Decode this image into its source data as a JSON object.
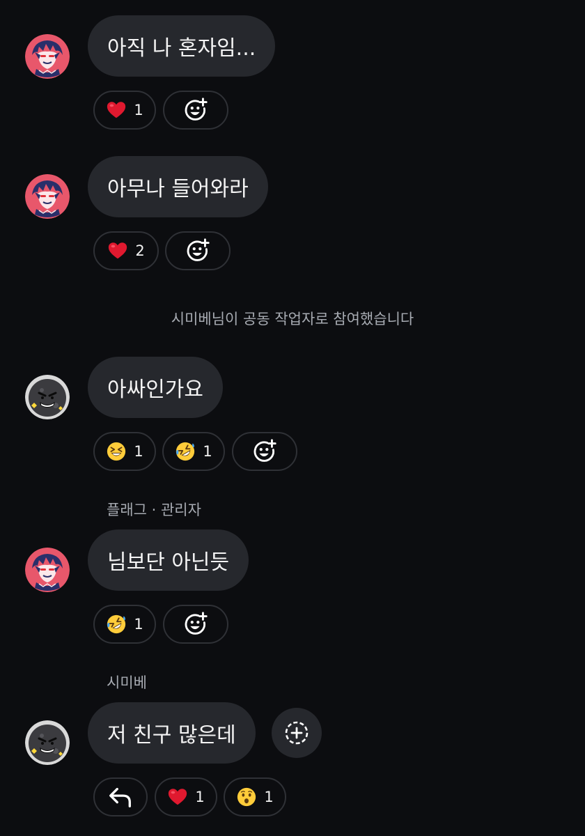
{
  "messages": [
    {
      "text": "아직 나 혼자임...",
      "reactions": [
        {
          "emoji": "heart",
          "count": "1"
        }
      ]
    },
    {
      "text": "아무나 들어와라",
      "reactions": [
        {
          "emoji": "heart",
          "count": "2"
        }
      ]
    },
    {
      "text": "아싸인가요",
      "reactions": [
        {
          "emoji": "grinning-squinting-face",
          "count": "1"
        },
        {
          "emoji": "rolling-on-floor-laughing",
          "count": "1"
        }
      ]
    },
    {
      "sender": "플래그 · 관리자",
      "text": "님보단 아닌듯",
      "reactions": [
        {
          "emoji": "rolling-on-floor-laughing",
          "count": "1"
        }
      ]
    },
    {
      "sender": "시미베",
      "text": "저 친구 많은데",
      "reactions": [
        {
          "emoji": "heart",
          "count": "1"
        },
        {
          "emoji": "hushed-face",
          "count": "1"
        }
      ]
    }
  ],
  "system_message": "시미베님이 공동 작업자로 참여했습니다",
  "colors": {
    "background": "#0c0d10",
    "bubble": "#26282d",
    "pill_border": "#2f3136",
    "muted_text": "#a7abb2",
    "heart": "#e0192f",
    "emoji_yellow": "#ffcc3a"
  }
}
